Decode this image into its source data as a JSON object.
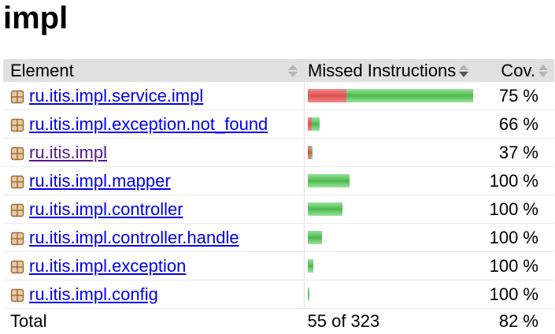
{
  "page": {
    "title": "impl"
  },
  "columns": {
    "element": "Element",
    "missed": "Missed Instructions",
    "cov": "Cov."
  },
  "rows": [
    {
      "name": "ru.itis.impl.service.impl",
      "cov": "75 %",
      "visited": false,
      "missed_fraction": 0.231,
      "covered_fraction": 0.769
    },
    {
      "name": "ru.itis.impl.exception.not_found",
      "cov": "66 %",
      "visited": false,
      "missed_fraction": 0.024,
      "covered_fraction": 0.048
    },
    {
      "name": "ru.itis.impl",
      "cov": "37 %",
      "visited": true,
      "missed_fraction": 0.019,
      "covered_fraction": 0.011
    },
    {
      "name": "ru.itis.impl.mapper",
      "cov": "100 %",
      "visited": false,
      "missed_fraction": 0.0,
      "covered_fraction": 0.25
    },
    {
      "name": "ru.itis.impl.controller",
      "cov": "100 %",
      "visited": false,
      "missed_fraction": 0.0,
      "covered_fraction": 0.21
    },
    {
      "name": "ru.itis.impl.controller.handle",
      "cov": "100 %",
      "visited": false,
      "missed_fraction": 0.0,
      "covered_fraction": 0.085
    },
    {
      "name": "ru.itis.impl.exception",
      "cov": "100 %",
      "visited": false,
      "missed_fraction": 0.0,
      "covered_fraction": 0.035
    },
    {
      "name": "ru.itis.impl.config",
      "cov": "100 %",
      "visited": false,
      "missed_fraction": 0.0,
      "covered_fraction": 0.008
    }
  ],
  "total": {
    "label": "Total",
    "missed": "55 of 323",
    "cov": "82 %"
  },
  "colors": {
    "missed": "#e05050",
    "covered": "#4cb84c",
    "link": "#0000ee",
    "visited": "#551a8b",
    "header_bg": "#e0e0e0"
  },
  "icons": {
    "package": "package-icon",
    "sort": "sort-arrows-icon"
  }
}
